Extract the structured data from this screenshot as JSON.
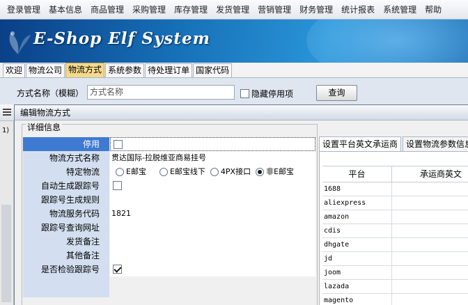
{
  "menu": [
    "登录管理",
    "基本信息",
    "商品管理",
    "采购管理",
    "库存管理",
    "发货管理",
    "营销管理",
    "财务管理",
    "统计报表",
    "系统管理",
    "帮助"
  ],
  "banner": {
    "title": "E-Shop Elf System"
  },
  "tabs": [
    "欢迎",
    "物流公司",
    "物流方式",
    "系统参数",
    "待处理订单",
    "国家代码"
  ],
  "active_tab_index": 2,
  "search": {
    "label": "方式名称（模糊）",
    "placeholder": "方式名称",
    "hide_disabled_label": "隐藏停用项",
    "hide_disabled_checked": false,
    "query_button": "查询"
  },
  "grid": {
    "row_indicator": "1"
  },
  "dialog": {
    "title": "编辑物流方式",
    "group_title": "详细信息",
    "fields": {
      "disabled": {
        "label": "停用",
        "checked": false
      },
      "name": {
        "label": "物流方式名称",
        "value": "贯达国际-拉脱维亚商易挂号"
      },
      "special": {
        "label": "特定物流",
        "options": [
          "E邮宝",
          "E邮宝线下",
          "4PX接口",
          "非E邮宝"
        ],
        "selected_index": 3
      },
      "auto_tracking": {
        "label": "自动生成跟踪号",
        "checked": false
      },
      "tracking_rule": {
        "label": "跟踪号生成规则",
        "value": ""
      },
      "service_code": {
        "label": "物流服务代码",
        "value": "1821"
      },
      "tracking_url": {
        "label": "跟踪号查询网址",
        "value": ""
      },
      "ship_note": {
        "label": "发货备注",
        "value": ""
      },
      "other_note": {
        "label": "其他备注",
        "value": ""
      },
      "verify_tracking": {
        "label": "是否检验跟踪号",
        "checked": true
      }
    },
    "right_tabs": [
      "设置平台英文承运商",
      "设置物流参数信息"
    ],
    "carrier_grid": {
      "headers": [
        "平台",
        "承运商英文"
      ],
      "rows": [
        "1688",
        "aliexpress",
        "amazon",
        "cdis",
        "dhgate",
        "jd",
        "joom",
        "lazada",
        "magento"
      ]
    }
  }
}
